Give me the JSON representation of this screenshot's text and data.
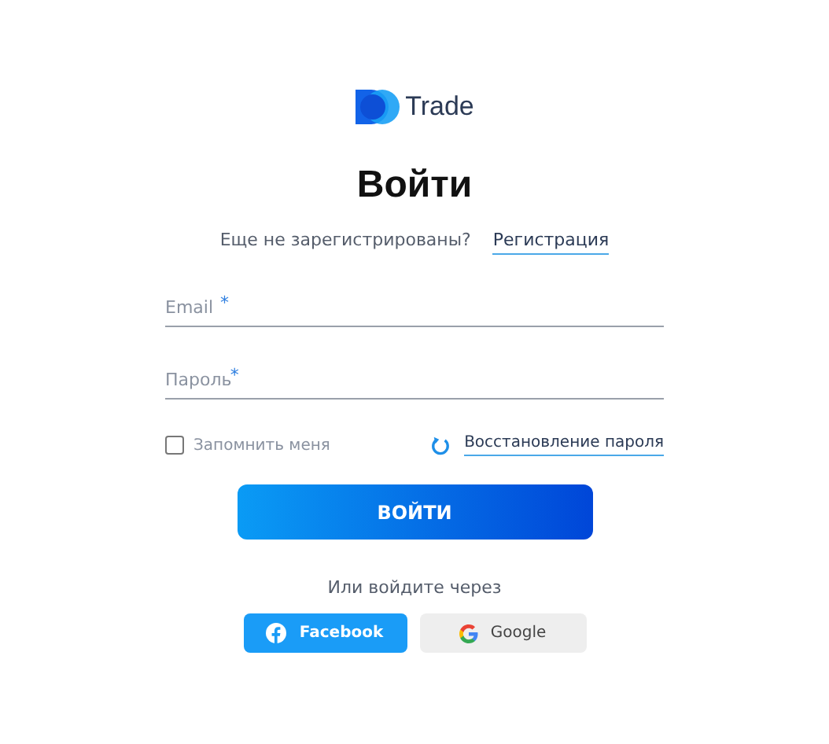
{
  "logo": {
    "text": "Trade"
  },
  "title": "Войти",
  "register": {
    "prompt": "Еще не зарегистрированы?",
    "link": "Регистрация"
  },
  "fields": [
    {
      "placeholder": "Email",
      "required_mark": "*"
    },
    {
      "placeholder": "Пароль",
      "required_mark": "*"
    }
  ],
  "remember": {
    "label": "Запомнить меня",
    "checked": false
  },
  "recover_link": "Восстановление пароля",
  "submit": "ВОЙТИ",
  "alt_prompt": "Или войдите через",
  "social": [
    {
      "kind": "facebook",
      "label": "Facebook"
    },
    {
      "kind": "google",
      "label": "Google"
    }
  ]
}
